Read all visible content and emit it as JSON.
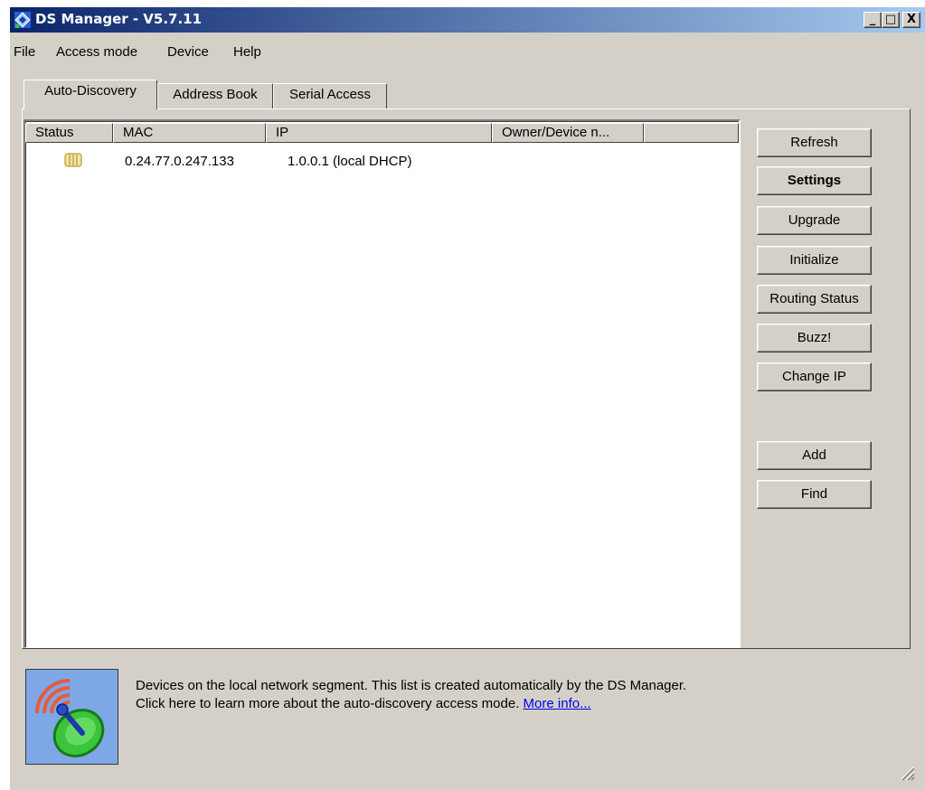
{
  "window": {
    "title": "DS Manager - V5.7.11",
    "controls": {
      "minimize": "_",
      "maximize": "□",
      "close": "X"
    }
  },
  "menu": [
    "File",
    "Access mode",
    "Device",
    "Help"
  ],
  "tabs": [
    {
      "label": "Auto-Discovery",
      "active": true
    },
    {
      "label": "Address Book",
      "active": false
    },
    {
      "label": "Serial Access",
      "active": false
    }
  ],
  "list": {
    "columns": [
      "Status",
      "MAC",
      "IP",
      "Owner/Device n..."
    ],
    "rows": [
      {
        "status_icon": "device-status-icon",
        "mac": "0.24.77.0.247.133",
        "ip": "1.0.0.1 (local DHCP)",
        "owner": ""
      }
    ]
  },
  "buttons": {
    "refresh": "Refresh",
    "settings": "Settings",
    "upgrade": "Upgrade",
    "initialize": "Initialize",
    "routing_status": "Routing Status",
    "buzz": "Buzz!",
    "change_ip": "Change IP",
    "add": "Add",
    "find": "Find"
  },
  "info": {
    "icon": "satellite-dish-icon",
    "line1": "Devices on the local network segment. This list is created automatically by the DS Manager.",
    "line2": "Click here to learn more about the auto-discovery access mode.",
    "link": "More info..."
  },
  "colors": {
    "titlebar_start": "#0a246a",
    "titlebar_end": "#a6caf0",
    "face": "#d4d0c8",
    "link": "#0000ee"
  }
}
